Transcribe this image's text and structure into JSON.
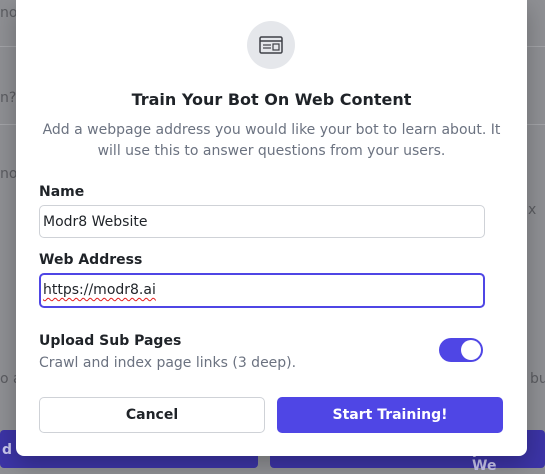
{
  "background": {
    "fragments": [
      "no",
      "n?",
      "no",
      "o a",
      "bu",
      "x"
    ],
    "left_button_label": "d",
    "right_button_label": "pload We"
  },
  "modal": {
    "icon": "browser-window-icon",
    "title": "Train Your Bot On Web Content",
    "description": "Add a webpage address you would like your bot to learn about. It will use this to answer questions from your users.",
    "name_label": "Name",
    "name_value": "Modr8 Website",
    "web_address_label": "Web Address",
    "web_address_value": "https://modr8.ai",
    "upload_subpages_title": "Upload Sub Pages",
    "upload_subpages_desc": "Crawl and index page links (3 deep).",
    "upload_subpages_enabled": true,
    "cancel_label": "Cancel",
    "start_label": "Start Training!"
  },
  "colors": {
    "accent": "#4f46e5",
    "overlay": "#8f9094"
  }
}
